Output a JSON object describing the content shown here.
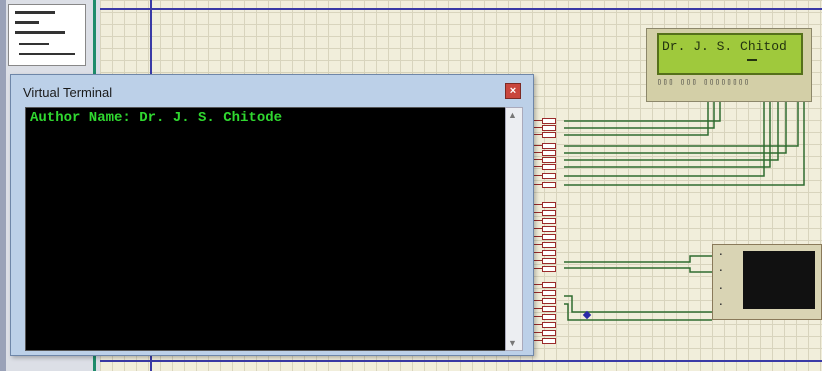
{
  "virtual_terminal": {
    "title": "Virtual Terminal",
    "output_line": "Author Name: Dr. J. S. Chitode",
    "close_symbol": "×"
  },
  "lcd": {
    "text": "Dr. J. S. Chitod"
  },
  "colors": {
    "terminal_background": "#000000",
    "terminal_text": "#30d830",
    "lcd_background": "#9fc93c",
    "schematic_background": "#f1eedb",
    "wire": "#2f6b2f"
  },
  "icons": [
    "close-icon",
    "scroll-up-icon",
    "scroll-down-icon"
  ]
}
